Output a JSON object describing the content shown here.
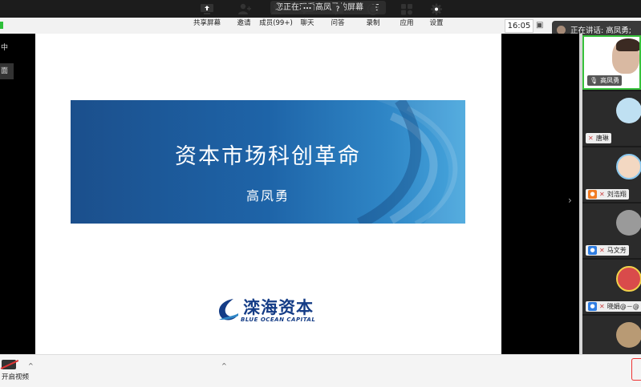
{
  "top": {
    "share_banner": "您正在观看高凤勇的屏幕",
    "menu_icon": "list-icon",
    "clock": "16:05",
    "active_speaker": "正在讲话: 高凤勇;"
  },
  "left_panel": {
    "tab1": "中",
    "tab2": "面"
  },
  "slide": {
    "title": "资本市场科创革命",
    "subtitle": "高凤勇",
    "logo_cn": "滦海资本",
    "logo_en": "BLUE OCEAN CAPITAL",
    "banner_color": "#1e64a8"
  },
  "gallery": {
    "participants": [
      {
        "name": "高凤勇",
        "active": true
      },
      {
        "name": "唐琳",
        "active": false
      },
      {
        "name": "刘浩翔",
        "active": false
      },
      {
        "name": "马文芳",
        "active": false
      },
      {
        "name": "晓娟@－@",
        "active": false
      }
    ]
  },
  "toolbar": {
    "camera": "开启视频",
    "share": "共享屏幕",
    "invite": "邀请",
    "members": "成员(99+)",
    "chat": "聊天",
    "qa": "问答",
    "record": "录制",
    "apps": "应用",
    "settings": "设置"
  },
  "colors": {
    "accent": "#37c23b",
    "leave": "#e33333"
  }
}
